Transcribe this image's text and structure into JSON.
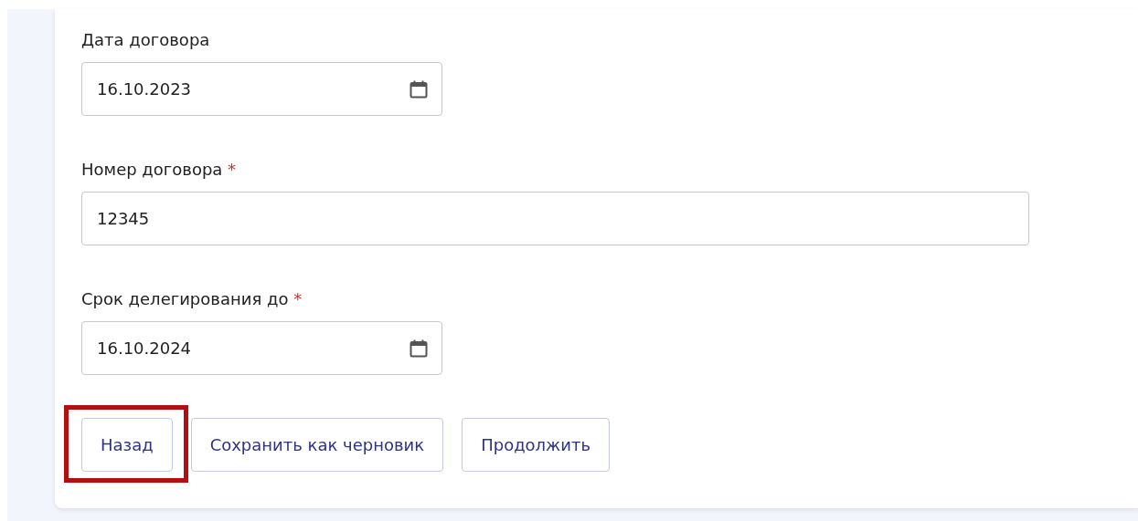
{
  "fields": [
    {
      "label": "Дата договора",
      "kind": "date",
      "value": "16.10.2023"
    },
    {
      "label": "Номер договора",
      "required_mark": "*",
      "kind": "text",
      "value": "12345"
    },
    {
      "label": "Срок делегирования до",
      "required_mark": "*",
      "kind": "date",
      "value": "16.10.2024"
    }
  ],
  "buttons": [
    {
      "label": "Назад",
      "highlighted": true
    },
    {
      "label": "Сохранить как черновик",
      "highlighted": false
    },
    {
      "label": "Продолжить",
      "highlighted": false
    }
  ]
}
